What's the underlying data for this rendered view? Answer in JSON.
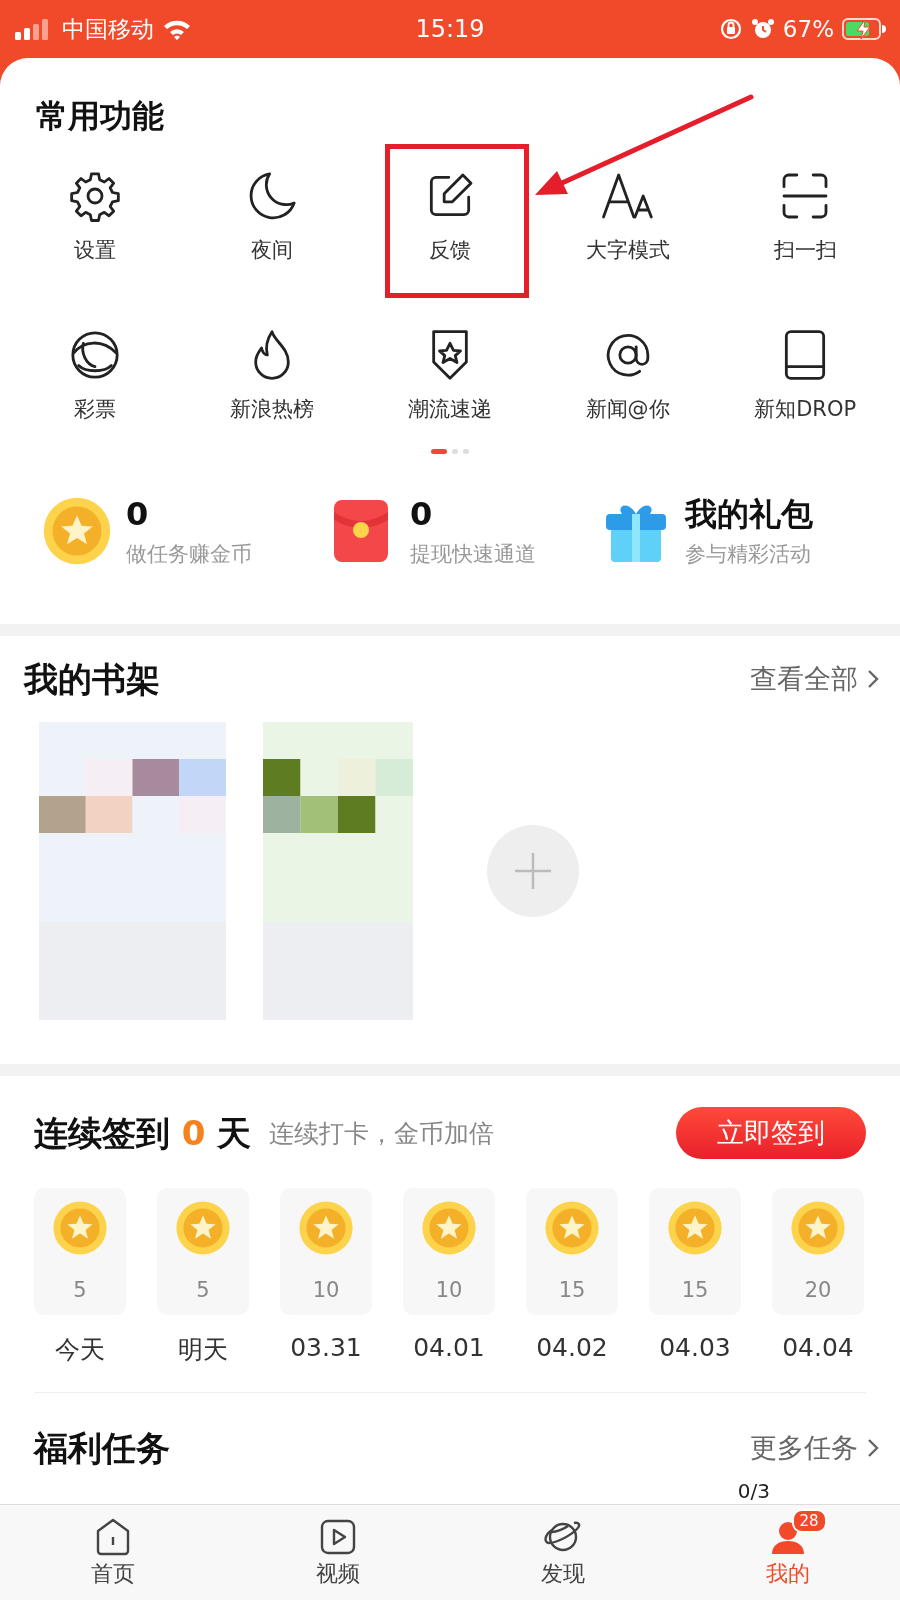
{
  "status_bar": {
    "carrier": "中国移动",
    "time": "15:19",
    "battery": "67%"
  },
  "functions": {
    "title": "常用功能",
    "items": [
      {
        "label": "设置",
        "kind": "gear",
        "highlighted": false
      },
      {
        "label": "夜间",
        "kind": "moon",
        "highlighted": false
      },
      {
        "label": "反馈",
        "kind": "edit",
        "highlighted": true
      },
      {
        "label": "大字模式",
        "kind": "font",
        "highlighted": false
      },
      {
        "label": "扫一扫",
        "kind": "scan",
        "highlighted": false
      },
      {
        "label": "彩票",
        "kind": "ball",
        "highlighted": false
      },
      {
        "label": "新浪热榜",
        "kind": "flame",
        "highlighted": false
      },
      {
        "label": "潮流速递",
        "kind": "badge",
        "highlighted": false
      },
      {
        "label": "新闻@你",
        "kind": "at",
        "highlighted": false
      },
      {
        "label": "新知DROP",
        "kind": "book",
        "highlighted": false
      }
    ],
    "pages": [
      {
        "selected": true
      },
      {
        "selected": false
      },
      {
        "selected": false
      }
    ]
  },
  "stats": [
    {
      "kind": "coin",
      "value": "0",
      "caption": "做任务赚金币"
    },
    {
      "kind": "envelope",
      "value": "0",
      "caption": "提现快速通道"
    },
    {
      "kind": "gift",
      "value": "我的礼包",
      "caption": "参与精彩活动"
    }
  ],
  "bookshelf": {
    "title": "我的书架",
    "more": "查看全部"
  },
  "checkin": {
    "title": "连续签到",
    "days": "0",
    "unit": "天",
    "hint": "连续打卡，金币加倍",
    "button": "立即签到",
    "rewards": [
      {
        "coins": "5",
        "date": "今天"
      },
      {
        "coins": "5",
        "date": "明天"
      },
      {
        "coins": "10",
        "date": "03.31"
      },
      {
        "coins": "10",
        "date": "04.01"
      },
      {
        "coins": "15",
        "date": "04.02"
      },
      {
        "coins": "15",
        "date": "04.03"
      },
      {
        "coins": "20",
        "date": "04.04"
      }
    ]
  },
  "tasks": {
    "title": "福利任务",
    "more": "更多任务",
    "progress": "0/3"
  },
  "tab_bar": [
    {
      "label": "首页",
      "kind": "home",
      "selected": false
    },
    {
      "label": "视频",
      "kind": "play",
      "selected": false
    },
    {
      "label": "发现",
      "kind": "planet",
      "selected": false
    },
    {
      "label": "我的",
      "kind": "person",
      "selected": true,
      "badge": "28"
    }
  ]
}
